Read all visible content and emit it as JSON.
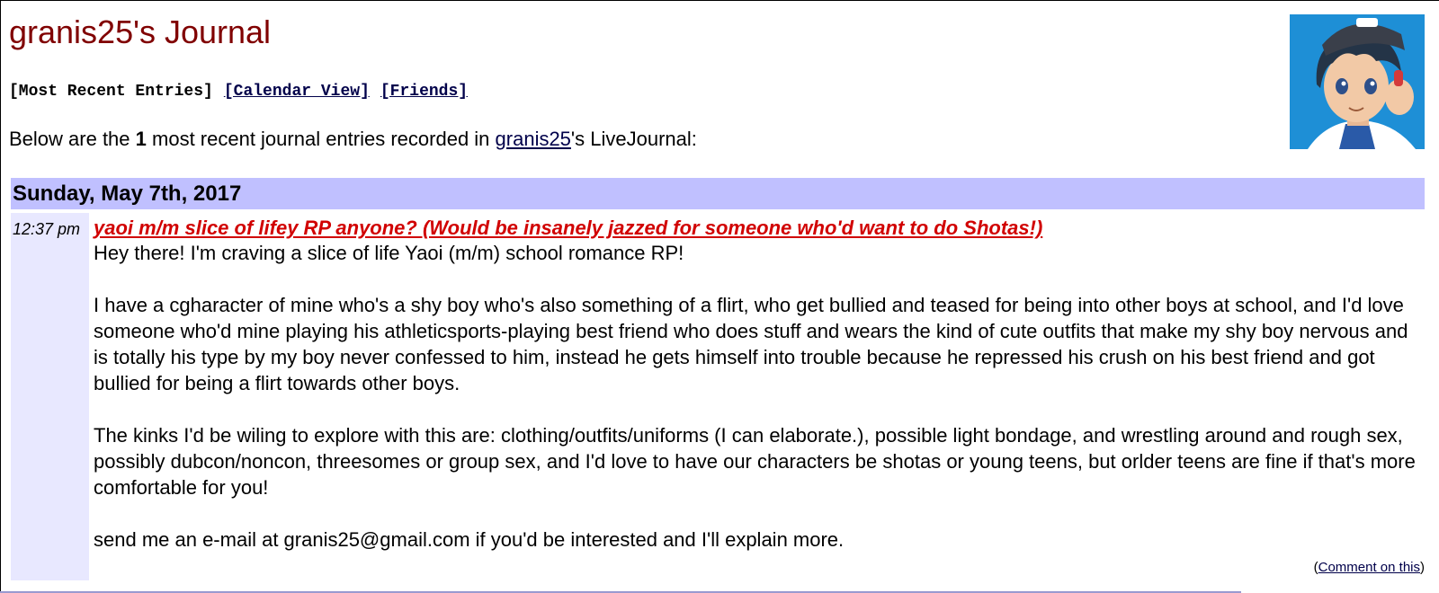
{
  "header": {
    "title": "granis25's Journal"
  },
  "nav": {
    "recent": "[Most Recent Entries]",
    "calendar": "[Calendar View]",
    "friends": "[Friends]"
  },
  "intro": {
    "prefix": "Below are the ",
    "count": "1",
    "middle": " most recent journal entries recorded in ",
    "username": "granis25",
    "suffix": "'s LiveJournal:"
  },
  "userpic": {
    "icon": "anime-boy-avatar-icon"
  },
  "entries": [
    {
      "date": "Sunday, May 7th, 2017",
      "time": "12:37 pm",
      "subject": "yaoi m/m slice of lifey RP anyone? (Would be insanely jazzed for someone who'd want to do Shotas!)",
      "paragraphs": [
        "Hey there! I'm craving a slice of life Yaoi (m/m) school romance RP!",
        "I have a cgharacter of mine who's a shy boy who's also something of a flirt, who get bullied and teased for being into other boys at school, and I'd love someone who'd mine playing his athleticsports-playing best friend who does stuff and wears the kind of cute outfits that make my shy boy nervous and is totally his type by my boy never confessed to him, instead he gets himself into trouble because he repressed his crush on his best friend and got bullied for being a flirt towards other boys.",
        "The kinks I'd be wiling to explore with this are: clothing/outfits/uniforms (I can elaborate.), possible light bondage, and wrestling around and rough sex, possibly dubcon/noncon, threesomes or group sex, and I'd love to have our characters be shotas or young teens, but orlder teens are fine if that's more comfortable for you!",
        "send me an e-mail at granis25@gmail.com if you'd be interested and I'll explain more."
      ],
      "comment_open": "(",
      "comment_label": "Comment on this",
      "comment_close": ")"
    }
  ],
  "colors": {
    "title": "#800000",
    "subject": "#d10000",
    "date_bar": "#c0c0ff",
    "time_column": "#e8e8ff",
    "link": "#00004a"
  }
}
